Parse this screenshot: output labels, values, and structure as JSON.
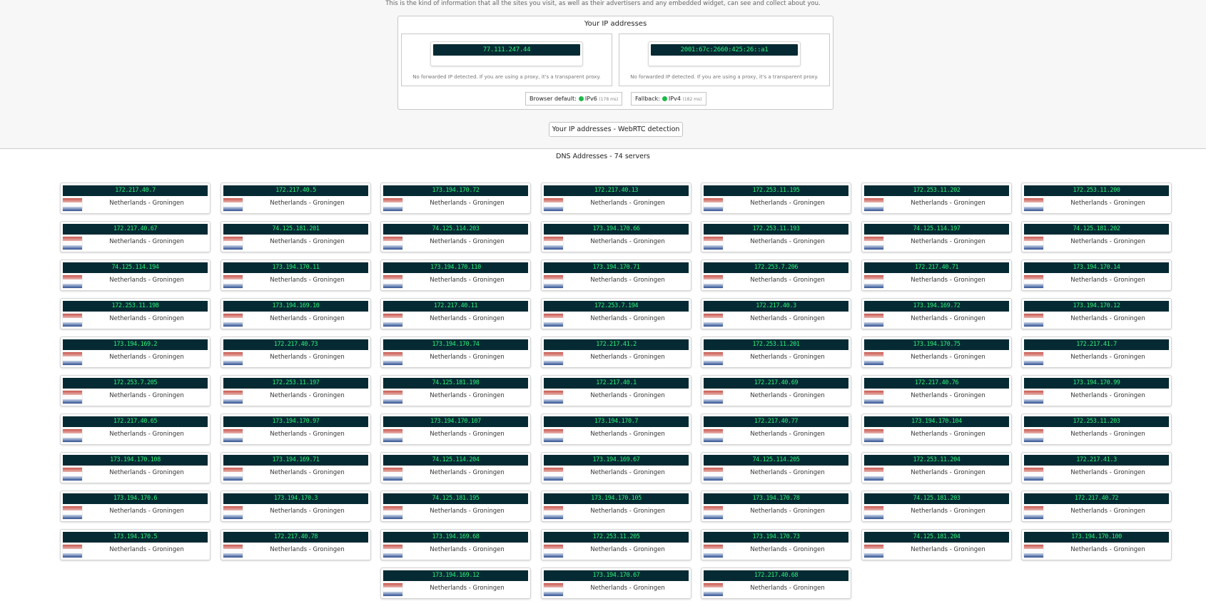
{
  "intro_text": "This is the kind of information that all the sites you visit, as well as their advertisers and any embedded widget, can see and collect about you.",
  "ip_panel": {
    "title": "Your IP addresses",
    "ipv4": "77.111.247.44",
    "ipv6": "2001:67c:2660:425:26::a1",
    "ipv4_note": "No forwarded IP detected. If you are using a proxy, it's a transparent proxy.",
    "ipv6_note": "No forwarded IP detected. If you are using a proxy, it's a transparent proxy.",
    "browser_default_label": "Browser default:",
    "browser_default_proto": "IPv6",
    "browser_default_ms": "(178 ms)",
    "fallback_label": "Fallback:",
    "fallback_proto": "IPv4",
    "fallback_ms": "(182 ms)",
    "status_color": "#1fb84a"
  },
  "webrtc_button": "Your IP addresses - WebRTC detection",
  "dns": {
    "title": "DNS Addresses - 74 servers",
    "location": "Netherlands - Groningen",
    "flag_icon": "netherlands-flag-icon",
    "servers": [
      "172.217.40.7",
      "172.217.40.5",
      "173.194.170.72",
      "172.217.40.13",
      "172.253.11.195",
      "172.253.11.202",
      "172.253.11.200",
      "172.217.40.67",
      "74.125.181.201",
      "74.125.114.203",
      "173.194.170.66",
      "172.253.11.193",
      "74.125.114.197",
      "74.125.181.202",
      "74.125.114.194",
      "173.194.170.11",
      "173.194.170.110",
      "173.194.170.71",
      "172.253.7.206",
      "172.217.40.71",
      "173.194.170.14",
      "172.253.11.198",
      "173.194.169.10",
      "172.217.40.11",
      "172.253.7.194",
      "172.217.40.3",
      "173.194.169.72",
      "173.194.170.12",
      "173.194.169.2",
      "172.217.40.73",
      "173.194.170.74",
      "172.217.41.2",
      "172.253.11.201",
      "173.194.170.75",
      "172.217.41.7",
      "172.253.7.205",
      "172.253.11.197",
      "74.125.181.198",
      "172.217.40.1",
      "172.217.40.69",
      "172.217.40.76",
      "173.194.170.99",
      "172.217.40.65",
      "173.194.170.97",
      "173.194.170.107",
      "173.194.170.7",
      "172.217.40.77",
      "173.194.170.104",
      "172.253.11.203",
      "173.194.170.108",
      "173.194.169.71",
      "74.125.114.204",
      "173.194.169.67",
      "74.125.114.205",
      "172.253.11.204",
      "172.217.41.3",
      "173.194.170.6",
      "173.194.170.3",
      "74.125.181.195",
      "173.194.170.105",
      "173.194.170.78",
      "74.125.181.203",
      "172.217.40.72",
      "173.194.170.5",
      "172.217.40.78",
      "173.194.169.68",
      "172.253.11.205",
      "173.194.170.73",
      "74.125.181.204",
      "173.194.170.100",
      "173.194.169.12",
      "173.194.170.67",
      "172.217.40.68"
    ]
  }
}
